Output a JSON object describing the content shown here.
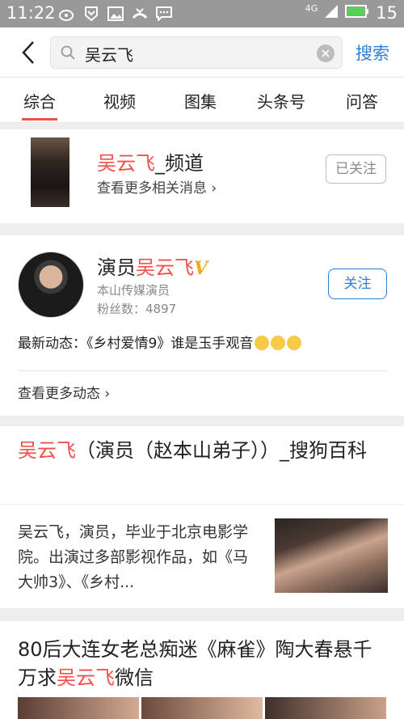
{
  "status_bar": {
    "time": "11:22",
    "network": "4G",
    "battery": "15"
  },
  "search": {
    "query": "吴云飞",
    "submit_label": "搜索"
  },
  "tabs": [
    {
      "label": "综合"
    },
    {
      "label": "视频"
    },
    {
      "label": "图集"
    },
    {
      "label": "头条号"
    },
    {
      "label": "问答"
    }
  ],
  "channel": {
    "name_highlight": "吴云飞",
    "name_suffix": "_频道",
    "subtitle": "查看更多相关消息 ›",
    "followed_label": "已关注"
  },
  "actor": {
    "prefix": "演员",
    "name_highlight": "吴云飞",
    "verified_badge": "V",
    "company": "本山传媒演员",
    "fans": "粉丝数：4897",
    "follow_label": "关注",
    "latest": "最新动态：《乡村爱情9》谁是玉手观音",
    "more": "查看更多动态 ›"
  },
  "baike": {
    "title_highlight": "吴云飞",
    "title_rest": "（演员（赵本山弟子））_搜狗百科",
    "summary": "吴云飞，演员，毕业于北京电影学院。出演过多部影视作品，如《马大帅3》、《乡村..."
  },
  "news": {
    "title_before": "80后大连女老总痴迷《麻雀》陶大春悬千万求",
    "title_highlight": "吴云飞",
    "title_after": "微信"
  },
  "colors": {
    "accent_red": "#f0524b",
    "link_blue": "#2c7fd6",
    "status_bar": "#999999"
  }
}
